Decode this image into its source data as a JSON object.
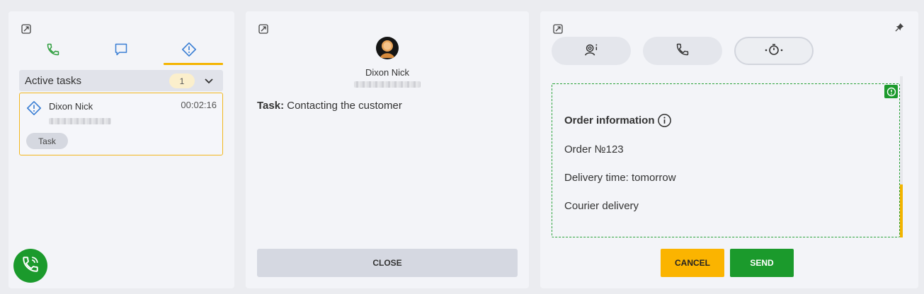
{
  "tasks_panel": {
    "tabs": [
      {
        "name": "calls",
        "icon": "phone-icon"
      },
      {
        "name": "chats",
        "icon": "chat-icon"
      },
      {
        "name": "tasks",
        "icon": "task-icon",
        "active": true
      }
    ],
    "section_title": "Active tasks",
    "count": "1",
    "task": {
      "name": "Dixon Nick",
      "time": "00:02:16",
      "chip": "Task"
    }
  },
  "detail_panel": {
    "contact_name": "Dixon Nick",
    "task_label": "Task:",
    "task_text": "Contacting the customer",
    "close_label": "CLOSE"
  },
  "form_panel": {
    "buttons": [
      "contact-info-icon",
      "phone-icon",
      "timer-icon"
    ],
    "title": "Order information",
    "lines": [
      "Order №123",
      "Delivery time: tomorrow",
      "Courier delivery"
    ],
    "cancel_label": "CANCEL",
    "send_label": "SEND"
  },
  "colors": {
    "accent_yellow": "#f4b400",
    "accent_green": "#1b9a2c",
    "phone_green": "#2f9e3f",
    "chat_blue": "#3b7fd4"
  }
}
